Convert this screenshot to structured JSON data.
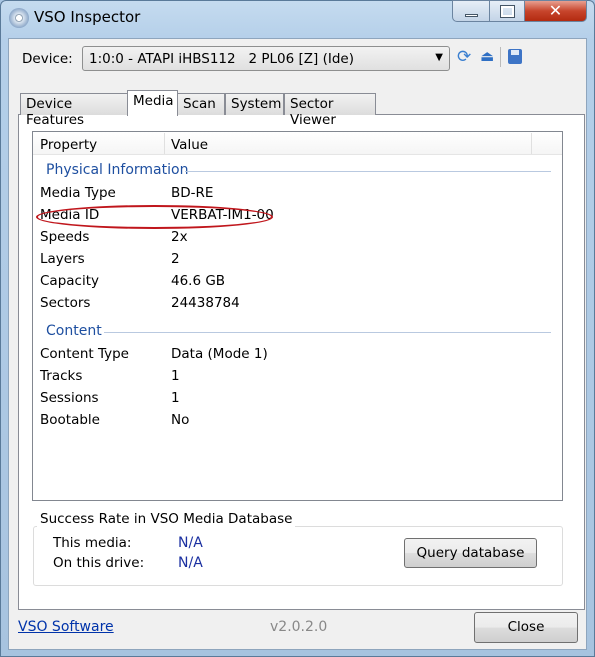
{
  "window": {
    "title": "VSO Inspector"
  },
  "device": {
    "label": "Device:",
    "value": "1:0:0 - ATAPI iHBS112   2 PL06 [Z] (Ide)"
  },
  "toolbar": {
    "icons": [
      "refresh-icon",
      "eject-icon",
      "save-icon"
    ]
  },
  "tabs": [
    {
      "label": "Device Features"
    },
    {
      "label": "Media",
      "active": true
    },
    {
      "label": "Scan"
    },
    {
      "label": "System"
    },
    {
      "label": "Sector Viewer"
    }
  ],
  "list": {
    "columns": [
      "Property",
      "Value"
    ],
    "groups": [
      {
        "title": "Physical Information",
        "rows": [
          [
            "Media Type",
            "BD-RE"
          ],
          [
            "Media ID",
            "VERBAT-IM1-00"
          ],
          [
            "Speeds",
            "2x"
          ],
          [
            "Layers",
            "2"
          ],
          [
            "Capacity",
            "46.6 GB"
          ],
          [
            "Sectors",
            "24438784"
          ]
        ]
      },
      {
        "title": "Content",
        "rows": [
          [
            "Content Type",
            "Data (Mode 1)"
          ],
          [
            "Tracks",
            "1"
          ],
          [
            "Sessions",
            "1"
          ],
          [
            "Bootable",
            "No"
          ]
        ]
      }
    ]
  },
  "database": {
    "title": "Success Rate in VSO Media Database",
    "this_media_label": "This media:",
    "this_media_value": "N/A",
    "drive_label": "On this drive:",
    "drive_value": "N/A",
    "query_button": "Query database"
  },
  "footer": {
    "link": "VSO Software",
    "version": "v2.0.2.0",
    "close": "Close"
  },
  "colors": {
    "group_text": "#1e4fa0",
    "na_text": "#1a2fa0",
    "highlight_ellipse": "#c0161c"
  }
}
